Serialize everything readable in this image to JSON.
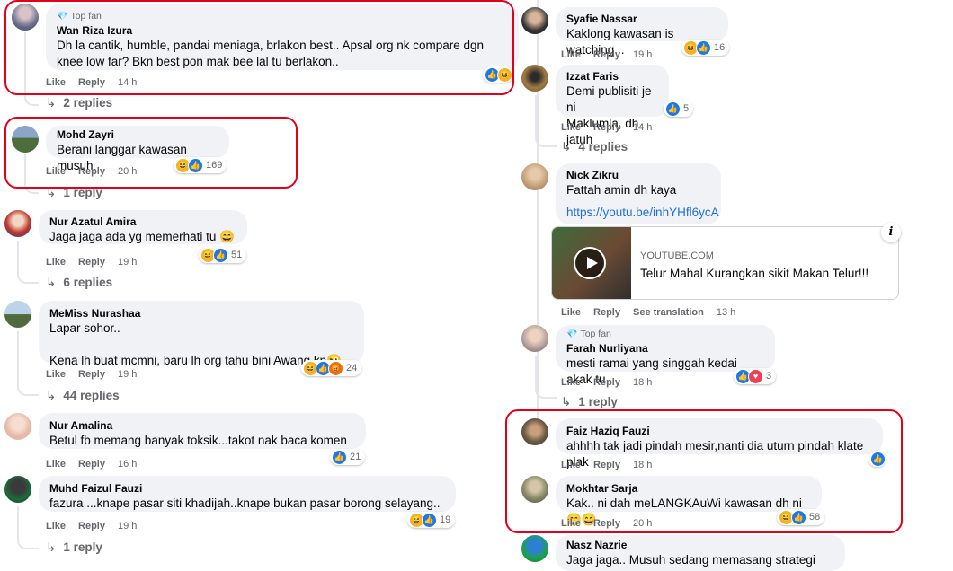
{
  "common": {
    "like": "Like",
    "reply": "Reply",
    "see_translation": "See translation",
    "top_fan": "Top fan"
  },
  "left": [
    {
      "author": "Wan Riza Izura",
      "top_fan": true,
      "text": "Dh la cantik, humble, pandai meniaga, brlakon best.. Apsal org nk compare dgn knee low far? Bkn best pon mak bee lal tu berlakon..",
      "time": "14 h",
      "reactions": [
        "like",
        "haha"
      ],
      "count": "",
      "replies": "2 replies"
    },
    {
      "author": "Mohd Zayri",
      "text": "Berani langgar kawasan musuh",
      "time": "20 h",
      "reactions": [
        "haha",
        "like"
      ],
      "count": "169",
      "replies": "1 reply"
    },
    {
      "author": "Nur Azatul Amira",
      "text": "Jaga jaga ada yg memerhati tu 😄",
      "time": "19 h",
      "reactions": [
        "haha",
        "like"
      ],
      "count": "51",
      "replies": "6 replies"
    },
    {
      "author": "MeMiss Nurashaa",
      "text": "Lapar sohor..\n\nKena lh buat mcmni, baru lh org tahu bini Awang kn😜",
      "time": "19 h",
      "reactions": [
        "haha",
        "like",
        "angry"
      ],
      "count": "24",
      "replies": "44 replies"
    },
    {
      "author": "Nur Amalina",
      "text": "Betul fb memang banyak toksik...takot nak baca komen",
      "time": "16 h",
      "reactions": [
        "like"
      ],
      "count": "21",
      "replies": ""
    },
    {
      "author": "Muhd Faizul Fauzi",
      "text": "fazura ...knape pasar siti khadijah..knape bukan pasar borong selayang..",
      "time": "19 h",
      "reactions": [
        "haha",
        "like"
      ],
      "count": "19",
      "replies": "1 reply"
    }
  ],
  "right": [
    {
      "author": "Syafie Nassar",
      "text": "Kaklong kawasan is watching...",
      "time": "19 h",
      "reactions": [
        "haha",
        "like"
      ],
      "count": "16"
    },
    {
      "author": "Izzat Faris",
      "text": "Demi publisiti je ni\nMaklumla, dh jatuh",
      "time": "14 h",
      "reactions": [
        "like"
      ],
      "count": "5",
      "replies": "4 replies"
    },
    {
      "author": "Nick Zikru",
      "text": "Fattah amin dh kaya",
      "link": "https://youtu.be/inhYHfl6ycA",
      "time": "13 h",
      "card": {
        "domain": "YOUTUBE.COM",
        "title": "Telur Mahal Kurangkan sikit Makan Telur!!!"
      }
    },
    {
      "author": "Farah Nurliyana",
      "top_fan": true,
      "text": "mesti ramai yang singgah kedai akak tu",
      "time": "18 h",
      "reactions": [
        "like",
        "love"
      ],
      "count": "3",
      "replies": "1 reply"
    },
    {
      "author": "Faiz Haziq Fauzi",
      "text": "ahhhh tak jadi pindah mesir,nanti dia uturn pindah klate plak",
      "time": "18 h",
      "reactions": [
        "like"
      ],
      "count": ""
    },
    {
      "author": "Mokhtar Sarja",
      "text": "Kak.. ni dah meLANGKAuWi kawasan dh ni 😁😄",
      "time": "20 h",
      "reactions": [
        "haha",
        "like"
      ],
      "count": "58"
    },
    {
      "author": "Nasz Nazrie",
      "text": "Jaga jaga.. Musuh sedang memasang strategi"
    }
  ],
  "colors": {
    "highlight": "#e3001b",
    "bubble": "#f0f2f5",
    "meta": "#65676b",
    "link": "#216fdb",
    "like": "#1877f2"
  }
}
